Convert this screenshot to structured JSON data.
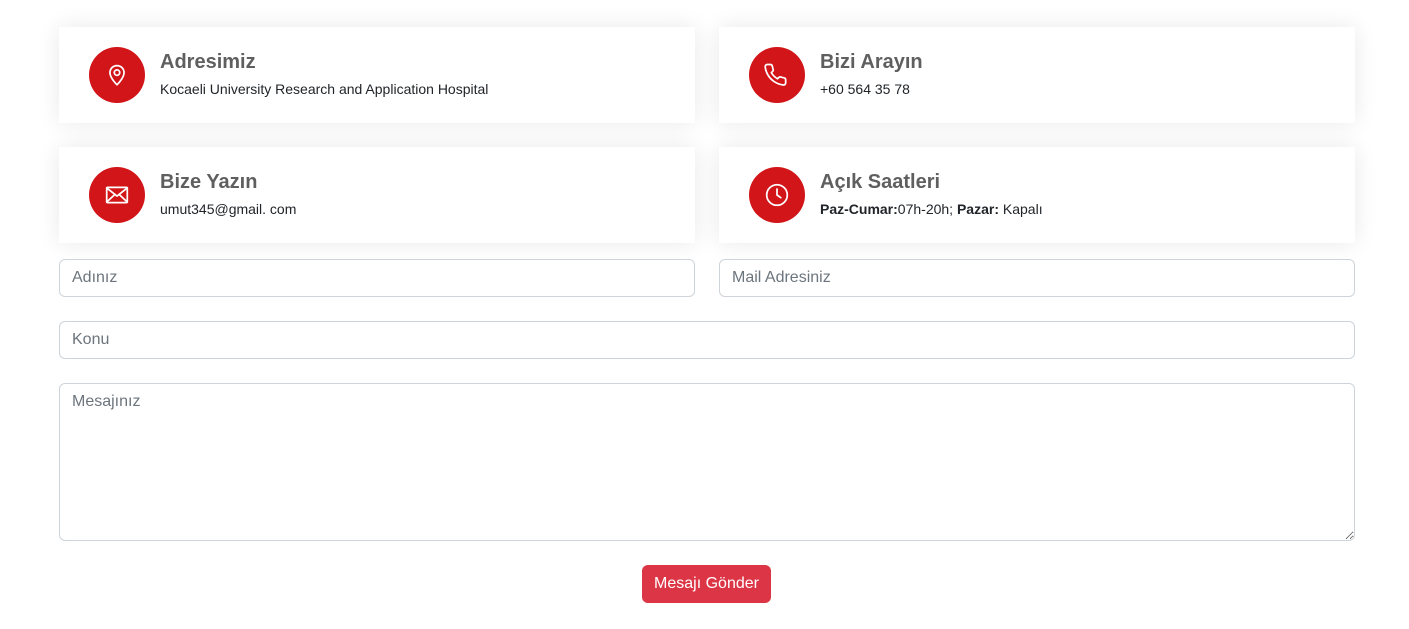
{
  "colors": {
    "accent": "#d11518",
    "button": "#dc3545",
    "heading": "#5f5f5f"
  },
  "cards": [
    {
      "icon": "map-pin-icon",
      "title": "Adresimiz",
      "text": "Kocaeli University Research and Application Hospital"
    },
    {
      "icon": "phone-icon",
      "title": "Bizi Arayın",
      "text": "+60 564 35 78"
    },
    {
      "icon": "envelope-icon",
      "title": "Bize Yazın",
      "text": "umut345@gmail. com"
    },
    {
      "icon": "clock-icon",
      "title": "Açık Saatleri",
      "hours": {
        "weekday_label": "Paz-Cumar:",
        "weekday_value": "07h-20h;",
        "weekend_label": "Pazar:",
        "weekend_value": "Kapalı"
      }
    }
  ],
  "form": {
    "name_placeholder": "Adınız",
    "email_placeholder": "Mail Adresiniz",
    "subject_placeholder": "Konu",
    "message_placeholder": "Mesajınız",
    "submit_label": "Mesajı Gönder"
  }
}
